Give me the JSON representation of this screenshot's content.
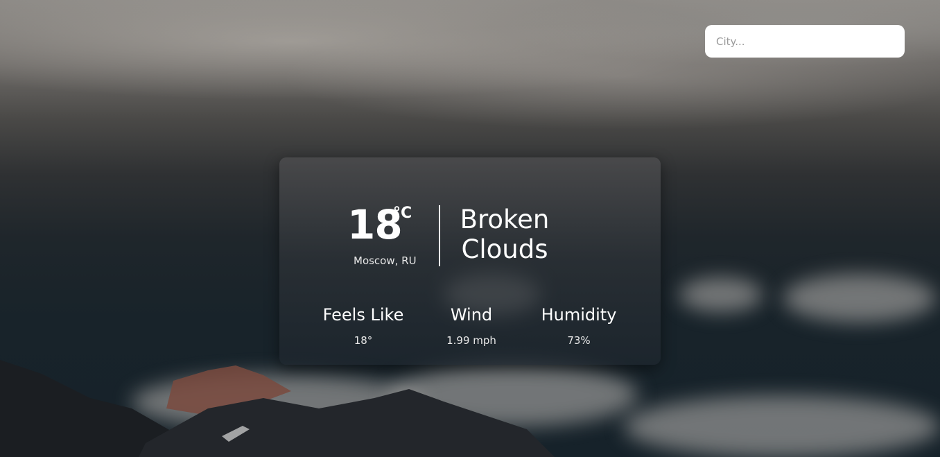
{
  "search": {
    "placeholder": "City...",
    "value": ""
  },
  "weather": {
    "temperature": "18",
    "unit": "°C",
    "location": "Moscow, RU",
    "condition_line1": "Broken",
    "condition_line2": "Clouds"
  },
  "stats": [
    {
      "label": "Feels Like",
      "value": "18°"
    },
    {
      "label": "Wind",
      "value": "1.99 mph"
    },
    {
      "label": "Humidity",
      "value": "73%"
    }
  ],
  "colors": {
    "card_background": "#2e3338",
    "text": "#ffffff",
    "input_background": "#ffffff",
    "sky_top": "#8d8a86",
    "sky_bottom": "#16222a"
  },
  "background": {
    "scene": "cloudy-mountain-sky"
  }
}
